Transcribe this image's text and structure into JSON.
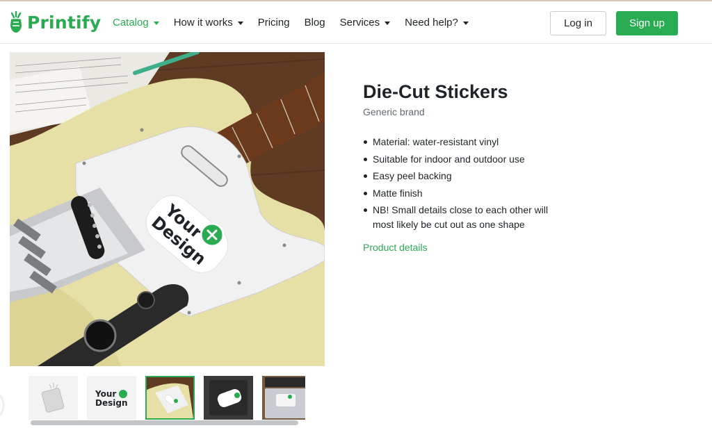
{
  "brand_color": "#29ab51",
  "header": {
    "logo_text": "Printify",
    "nav": [
      {
        "label": "Catalog",
        "dropdown": true,
        "active": true
      },
      {
        "label": "How it works",
        "dropdown": true,
        "active": false
      },
      {
        "label": "Pricing",
        "dropdown": false,
        "active": false
      },
      {
        "label": "Blog",
        "dropdown": false,
        "active": false
      },
      {
        "label": "Services",
        "dropdown": true,
        "active": false
      },
      {
        "label": "Need help?",
        "dropdown": true,
        "active": false
      }
    ],
    "login_label": "Log in",
    "signup_label": "Sign up"
  },
  "gallery": {
    "sticker_line1": "Your",
    "sticker_line2": "Design",
    "selected_index": 2,
    "thumbnails": [
      "sticker-sheet-icon",
      "your-design-sticker",
      "guitar-sticker",
      "laptop-dark-sticker",
      "laptop-keyboard-sticker"
    ]
  },
  "product": {
    "title": "Die-Cut Stickers",
    "brand": "Generic brand",
    "features": [
      "Material: water-resistant vinyl",
      "Suitable for indoor and outdoor use",
      "Easy peel backing",
      "Matte finish",
      "NB! Small details close to each other will most likely be cut out as one shape"
    ],
    "details_link": "Product details"
  }
}
